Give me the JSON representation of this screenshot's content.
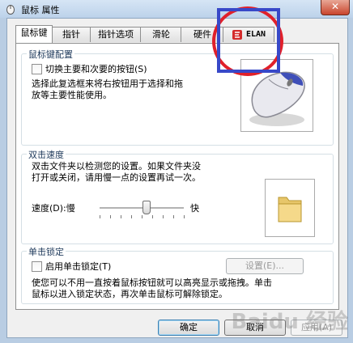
{
  "window": {
    "title": "鼠标 属性",
    "close_label": "✕"
  },
  "tabs": [
    {
      "label": "鼠标键"
    },
    {
      "label": "指针"
    },
    {
      "label": "指针选项"
    },
    {
      "label": "滑轮"
    },
    {
      "label": "硬件"
    },
    {
      "label": "ELAN"
    }
  ],
  "button_config": {
    "legend": "鼠标键配置",
    "switch_label": "切换主要和次要的按钮(S)",
    "switch_checked": false,
    "description_line1": "选择此复选框来将右按钮用于选择和拖",
    "description_line2": "放等主要性能使用。"
  },
  "double_click": {
    "legend": "双击速度",
    "description_line1": "双击文件夹以检测您的设置。如果文件夹没",
    "description_line2": "打开或关闭，请用慢一点的设置再试一次。",
    "speed_label": "速度(D):慢",
    "fast_label": "快",
    "speed_level": 0.55
  },
  "click_lock": {
    "legend": "单击锁定",
    "enable_label": "启用单击锁定(T)",
    "enable_checked": false,
    "settings_label": "设置(E)...",
    "description_line1": "使您可以不用一直按着鼠标按钮就可以高亮显示或拖拽。单击",
    "description_line2": "鼠标以进入锁定状态，再次单击鼠标可解除锁定。"
  },
  "footer": {
    "ok_label": "确定",
    "cancel_label": "取消",
    "apply_label": "应用(A)"
  },
  "watermark": "Baidu 经验",
  "colors": {
    "annotation_rect": "#3848c8",
    "annotation_circle": "#e0202a",
    "titlebar": "#bcd2ea"
  }
}
